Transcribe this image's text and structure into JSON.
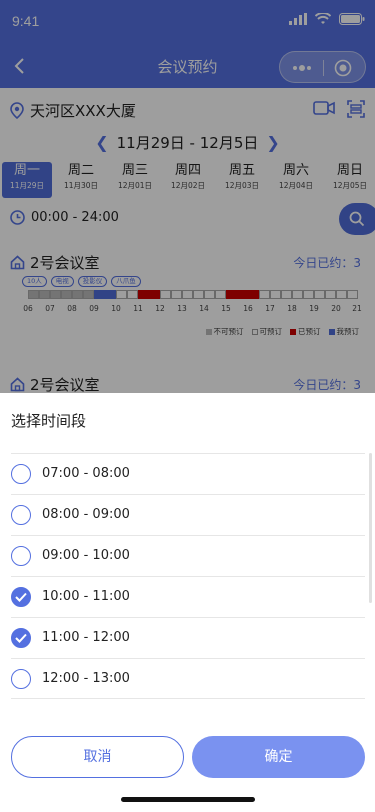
{
  "status": {
    "time": "9:41"
  },
  "nav": {
    "title": "会议预约"
  },
  "location": {
    "text": "天河区XXX大厦"
  },
  "date_range": {
    "text": "11月29日 - 12月5日"
  },
  "week": [
    {
      "weekday": "周一",
      "date": "11月29日",
      "active": true
    },
    {
      "weekday": "周二",
      "date": "11月30日"
    },
    {
      "weekday": "周三",
      "date": "12月01日"
    },
    {
      "weekday": "周四",
      "date": "12月02日"
    },
    {
      "weekday": "周五",
      "date": "12月03日"
    },
    {
      "weekday": "周六",
      "date": "12月04日"
    },
    {
      "weekday": "周日",
      "date": "12月05日"
    }
  ],
  "time_filter": {
    "text": "00:00 - 24:00"
  },
  "rooms": [
    {
      "name": "2号会议室",
      "today_status": "今日已约：3",
      "tags": [
        "10人",
        "电视",
        "投影仪",
        "八爪鱼"
      ],
      "tick_labels": [
        "06",
        "07",
        "08",
        "09",
        "10",
        "11",
        "12",
        "13",
        "14",
        "15",
        "16",
        "17",
        "18",
        "19",
        "20",
        "21"
      ]
    },
    {
      "name": "2号会议室",
      "today_status": "今日已约：3"
    }
  ],
  "legend": {
    "unavailable": "不可预订",
    "available": "可预订",
    "booked": "已预订",
    "mine": "我预订"
  },
  "colors": {
    "accent": "#5470e0",
    "booked": "#cc0000",
    "mine": "#4f6cd8",
    "unavailable": "#bbbbbb"
  },
  "sheet": {
    "title": "选择时间段",
    "slots": [
      {
        "label": "07:00 - 08:00",
        "checked": false
      },
      {
        "label": "08:00 - 09:00",
        "checked": false
      },
      {
        "label": "09:00 - 10:00",
        "checked": false
      },
      {
        "label": "10:00 - 11:00",
        "checked": true
      },
      {
        "label": "11:00 - 12:00",
        "checked": true
      },
      {
        "label": "12:00 - 13:00",
        "checked": false
      }
    ],
    "cancel_label": "取消",
    "confirm_label": "确定"
  }
}
